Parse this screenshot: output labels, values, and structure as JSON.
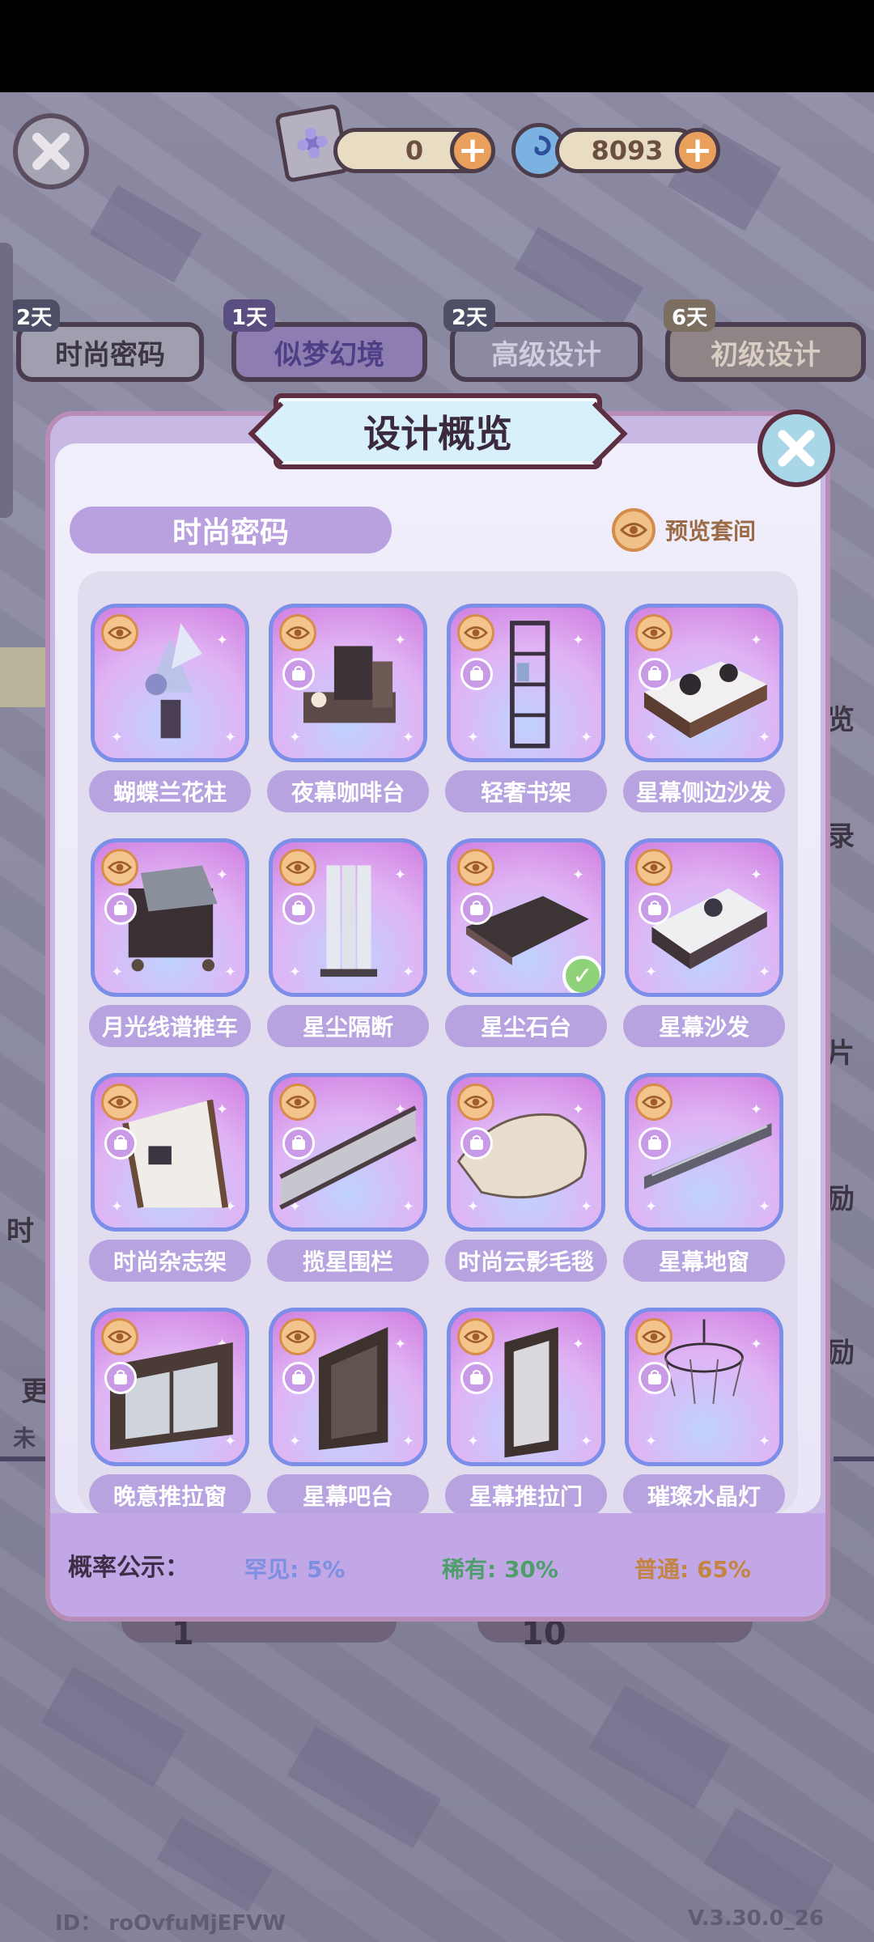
{
  "colors": {
    "modal_bg": "#c8b8e4",
    "rare": "#7d8fe0",
    "uncommon": "#4e9e6a",
    "common": "#c48443"
  },
  "currency": {
    "ticket_count": "0",
    "gem_count": "8093"
  },
  "tabs": [
    {
      "days": "2天",
      "label": "时尚密码"
    },
    {
      "days": "1天",
      "label": "似梦幻境"
    },
    {
      "days": "2天",
      "label": "高级设计"
    },
    {
      "days": "6天",
      "label": "初级设计"
    }
  ],
  "background_partial": {
    "right_1": "览",
    "right_2": "录",
    "right_3": "片",
    "right_4": "励",
    "right_5": "励",
    "left_1": "时",
    "left_2": "更",
    "left_3": "未",
    "draw_1": "1",
    "draw_10": "10"
  },
  "modal": {
    "title": "设计概览",
    "set_name": "时尚密码",
    "preview_label": "预览套间"
  },
  "items": [
    {
      "name": "蝴蝶兰花柱",
      "owned": false
    },
    {
      "name": "夜幕咖啡台",
      "owned": false
    },
    {
      "name": "轻奢书架",
      "owned": false
    },
    {
      "name": "星幕侧边沙发",
      "owned": false
    },
    {
      "name": "月光线谱推车",
      "owned": false
    },
    {
      "name": "星尘隔断",
      "owned": false
    },
    {
      "name": "星尘石台",
      "owned": true
    },
    {
      "name": "星幕沙发",
      "owned": false
    },
    {
      "name": "时尚杂志架",
      "owned": false
    },
    {
      "name": "揽星围栏",
      "owned": false
    },
    {
      "name": "时尚云影毛毯",
      "owned": false
    },
    {
      "name": "星幕地窗",
      "owned": false
    },
    {
      "name": "晚意推拉窗",
      "owned": false
    },
    {
      "name": "星幕吧台",
      "owned": false
    },
    {
      "name": "星幕推拉门",
      "owned": false
    },
    {
      "name": "璀璨水晶灯",
      "owned": false
    }
  ],
  "probability": {
    "title": "概率公示：",
    "rare": "罕见: 5%",
    "uncommon": "稀有: 30%",
    "common": "普通: 65%"
  },
  "footer": {
    "id": "ID： roOvfuMjEFVW",
    "version": "V.3.30.0_26"
  }
}
